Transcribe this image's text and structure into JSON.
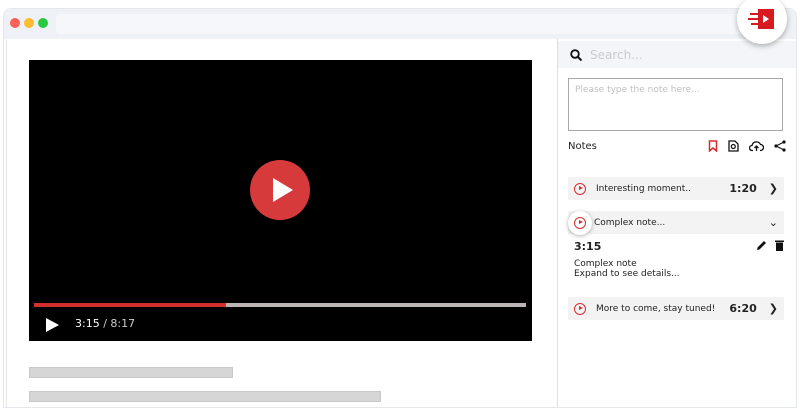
{
  "colors": {
    "accent": "#d32f2f",
    "play_button": "#d63a3a"
  },
  "player": {
    "current_time": "3:15",
    "separator": "/",
    "duration": "8:17",
    "progress_percent": 39
  },
  "sidebar": {
    "search_placeholder": "Search...",
    "note_placeholder": "Please type the note here...",
    "notes_label": "Notes",
    "toolbar_icons": [
      "bookmark-icon",
      "search-document-icon",
      "cloud-upload-icon",
      "share-icon"
    ],
    "notes": [
      {
        "title": "Interesting moment..",
        "time": "1:20"
      },
      {
        "title": "Complex note...",
        "time": "3:15",
        "body_line1": "Complex note",
        "body_line2": "Expand to see details..."
      },
      {
        "title": "More to come, stay tuned!",
        "time": "6:20"
      }
    ]
  }
}
